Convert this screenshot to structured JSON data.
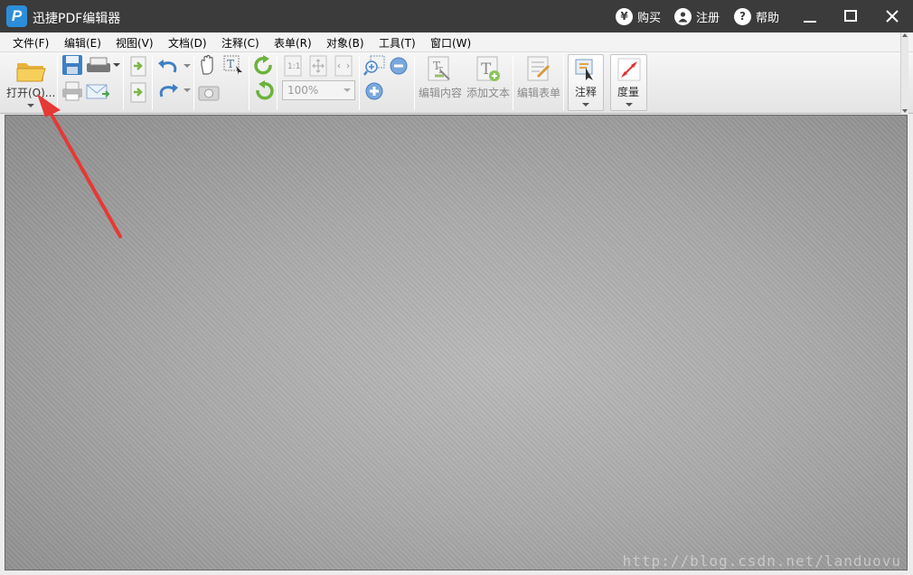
{
  "titlebar": {
    "title": "迅捷PDF编辑器",
    "logo_letter": "P",
    "buy_label": "购买",
    "register_label": "注册",
    "help_label": "帮助"
  },
  "menu": [
    {
      "label": "文件(F)"
    },
    {
      "label": "编辑(E)"
    },
    {
      "label": "视图(V)"
    },
    {
      "label": "文档(D)"
    },
    {
      "label": "注释(C)"
    },
    {
      "label": "表单(R)"
    },
    {
      "label": "对象(B)"
    },
    {
      "label": "工具(T)"
    },
    {
      "label": "窗口(W)"
    }
  ],
  "toolbar": {
    "open_label": "打开(O)...",
    "zoom_value": "100%",
    "edit_content_label": "编辑内容",
    "add_text_label": "添加文本",
    "edit_form_label": "编辑表单",
    "annotate_label": "注释",
    "measure_label": "度量"
  },
  "document": {
    "watermark": "http://blog.csdn.net/landuovu"
  },
  "colors": {
    "titlebar_bg": "#3b3b3b",
    "logo_blue": "#2c8ed8",
    "arrow_red": "#e53935"
  }
}
